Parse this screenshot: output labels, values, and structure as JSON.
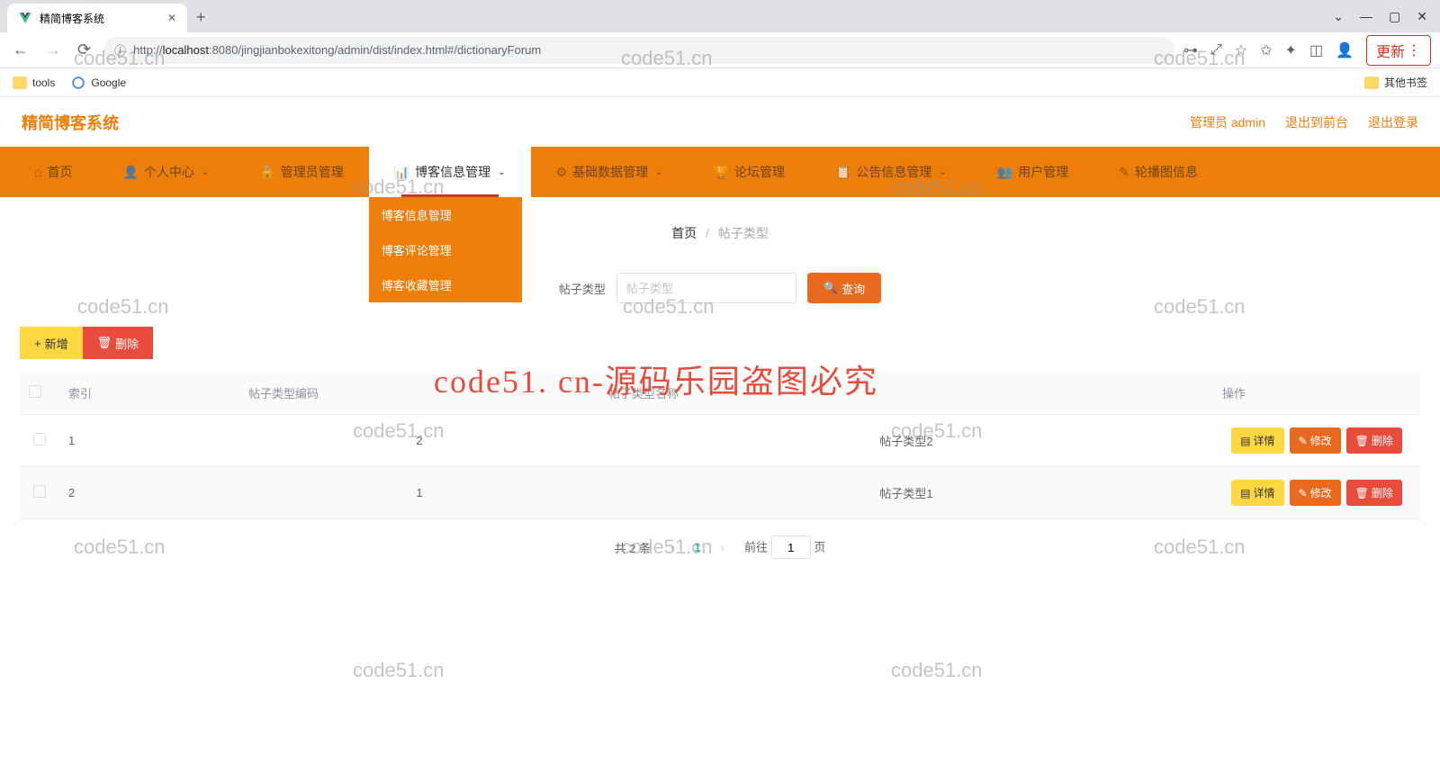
{
  "browser": {
    "tab_title": "精简博客系统",
    "url_prefix": "http://",
    "url_host": "localhost",
    "url_path": ":8080/jingjianbokexitong/admin/dist/index.html#/dictionaryForum",
    "update_label": "更新",
    "bookmarks": {
      "tools": "tools",
      "google": "Google",
      "other": "其他书签"
    }
  },
  "header": {
    "app_title": "精简博客系统",
    "admin_label": "管理员 admin",
    "to_front": "退出到前台",
    "logout": "退出登录"
  },
  "nav": {
    "items": [
      {
        "label": "首页",
        "icon": "⌂"
      },
      {
        "label": "个人中心",
        "icon": "👤",
        "caret": true
      },
      {
        "label": "管理员管理",
        "icon": "🔒"
      },
      {
        "label": "博客信息管理",
        "icon": "📊",
        "caret": true,
        "active": true
      },
      {
        "label": "基础数据管理",
        "icon": "⚙",
        "caret": true
      },
      {
        "label": "论坛管理",
        "icon": "🏆"
      },
      {
        "label": "公告信息管理",
        "icon": "📋",
        "caret": true
      },
      {
        "label": "用户管理",
        "icon": "👥"
      },
      {
        "label": "轮播图信息",
        "icon": "✎"
      }
    ],
    "dropdown": [
      "博客信息管理",
      "博客评论管理",
      "博客收藏管理"
    ]
  },
  "breadcrumb": {
    "home": "首页",
    "current": "帖子类型"
  },
  "filter": {
    "label": "帖子类型",
    "placeholder": "帖子类型",
    "search": "查询"
  },
  "actions": {
    "add": "新增",
    "delete": "删除"
  },
  "table": {
    "headers": {
      "idx": "索引",
      "code": "帖子类型编码",
      "name": "帖子类型名称",
      "action": "操作"
    },
    "rows": [
      {
        "idx": "1",
        "code": "2",
        "name": "帖子类型2"
      },
      {
        "idx": "2",
        "code": "1",
        "name": "帖子类型1"
      }
    ],
    "row_actions": {
      "detail": "详情",
      "edit": "修改",
      "delete": "删除"
    }
  },
  "pagination": {
    "total": "共 2 条",
    "page": "1",
    "goto_prefix": "前往",
    "goto_suffix": "页",
    "goto_value": "1"
  },
  "watermark": {
    "text": "code51.cn",
    "big": "code51. cn-源码乐园盗图必究"
  }
}
